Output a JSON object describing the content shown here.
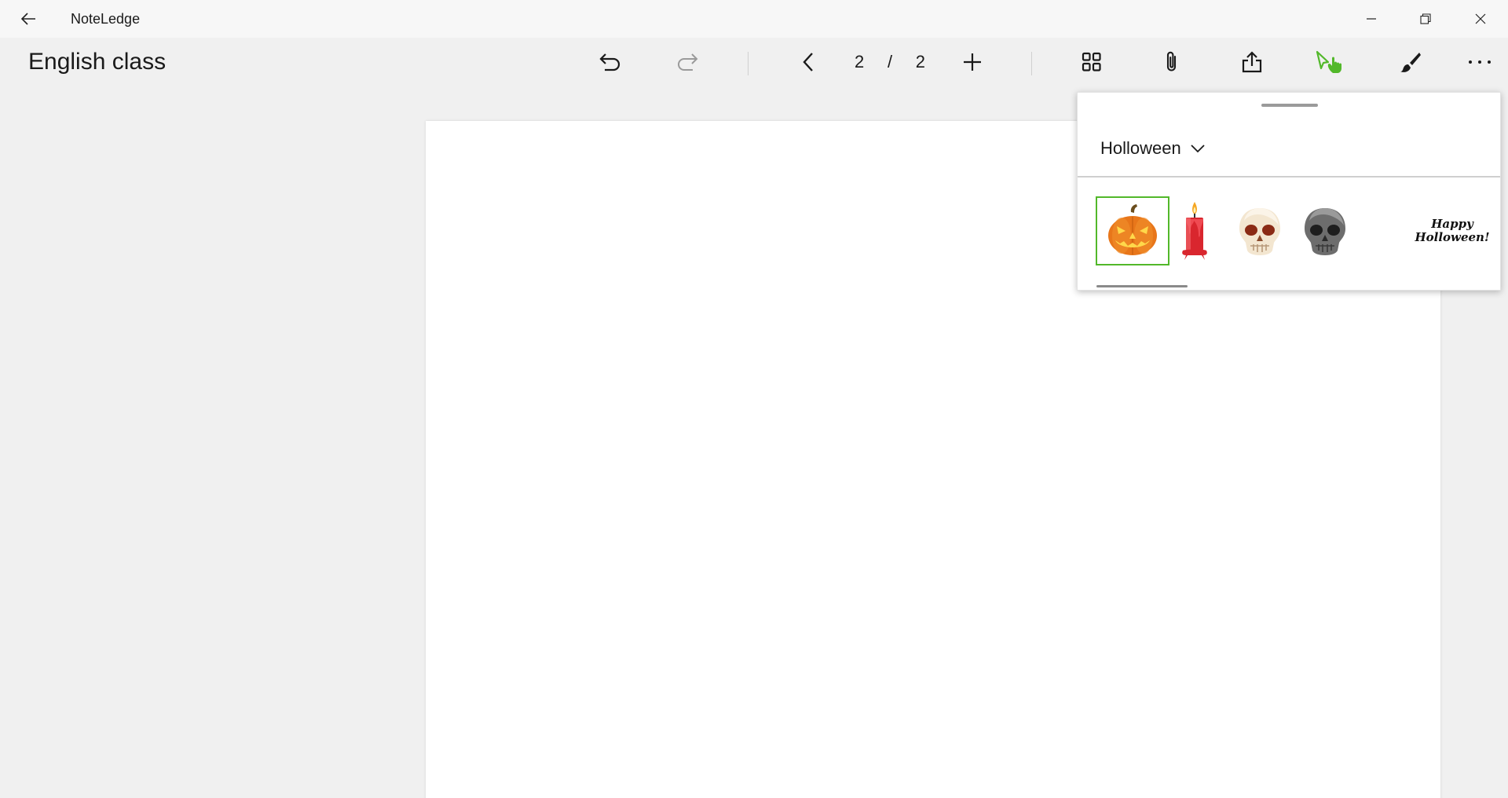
{
  "window": {
    "app_title": "NoteLedge",
    "back_icon": "back-arrow-icon",
    "controls": [
      "minimize-icon",
      "restore-icon",
      "close-icon"
    ]
  },
  "toolbar": {
    "document_title": "English class",
    "current_page": "2",
    "page_separator": "/",
    "total_pages": "2",
    "icons": [
      "undo-icon",
      "redo-icon",
      "previous-page-icon",
      "add-page-icon",
      "thumbnails-icon",
      "attachment-icon",
      "share-icon",
      "select-touch-icon",
      "brush-icon",
      "more-icon"
    ],
    "accent_color": "#52b82a"
  },
  "sticker_panel": {
    "category": "Holloween",
    "stickers": [
      {
        "name": "jack-o-lantern",
        "selected": true
      },
      {
        "name": "red-candle",
        "selected": false
      },
      {
        "name": "skull-white",
        "selected": false
      },
      {
        "name": "skull-grey",
        "selected": false
      },
      {
        "name": "happy-holloween-text",
        "selected": false,
        "text_line1": "Happy",
        "text_line2": "Holloween!"
      }
    ]
  }
}
